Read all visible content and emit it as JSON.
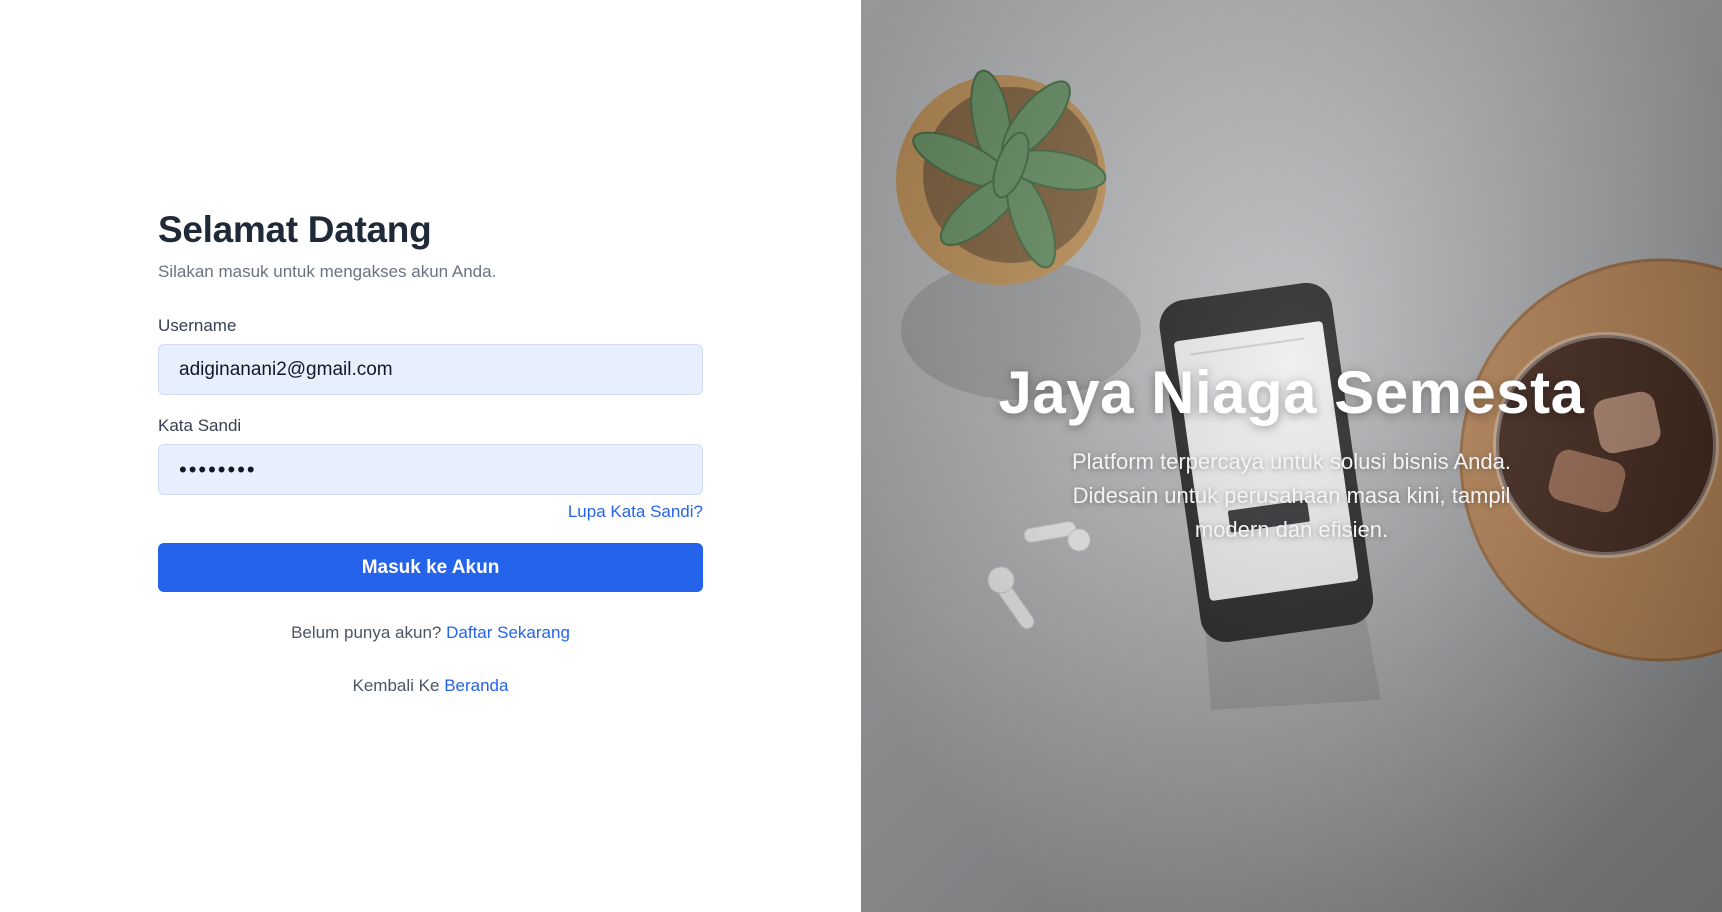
{
  "login": {
    "title": "Selamat Datang",
    "subtitle": "Silakan masuk untuk mengakses akun Anda.",
    "username_label": "Username",
    "username_value": "adiginanani2@gmail.com",
    "password_label": "Kata Sandi",
    "password_value": "••••••••",
    "forgot_link": "Lupa Kata Sandi?",
    "submit_label": "Masuk ke Akun",
    "register_prompt": "Belum punya akun?",
    "register_link": "Daftar Sekarang",
    "back_prompt": "Kembali Ke",
    "back_link": "Beranda"
  },
  "hero": {
    "title": "Jaya Niaga Semesta",
    "description": "Platform terpercaya untuk solusi bisnis Anda. Didesain untuk perusahaan masa kini, tampil modern dan efisien."
  },
  "colors": {
    "primary": "#2563eb",
    "title": "#1f2937",
    "input_bg": "#e8effc"
  }
}
